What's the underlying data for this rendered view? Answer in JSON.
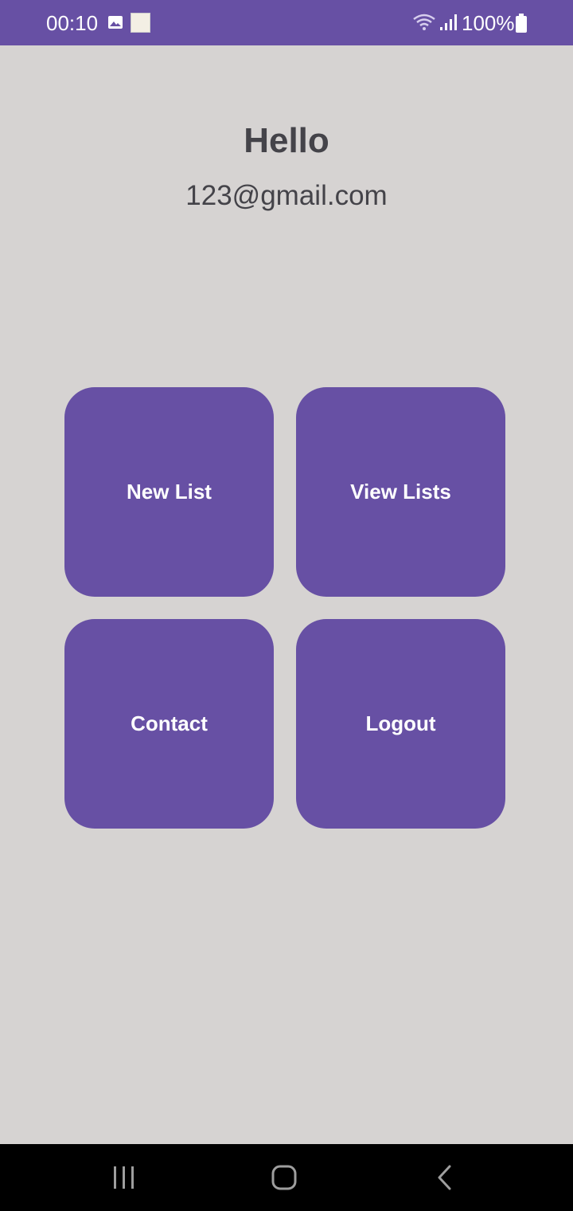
{
  "status_bar": {
    "time": "00:10",
    "battery_percent": "100%",
    "icons": [
      "image-icon",
      "app-notification-icon",
      "wifi-icon",
      "signal-icon",
      "battery-icon"
    ]
  },
  "header": {
    "greeting": "Hello",
    "email": "123@gmail.com"
  },
  "menu": {
    "new_list": "New List",
    "view_lists": "View Lists",
    "contact": "Contact",
    "logout": "Logout"
  },
  "nav_bar": {
    "icons": [
      "recents-icon",
      "home-icon",
      "back-icon"
    ]
  },
  "colors": {
    "accent": "#6750a4",
    "background": "#d6d3d2",
    "text": "#444349"
  }
}
